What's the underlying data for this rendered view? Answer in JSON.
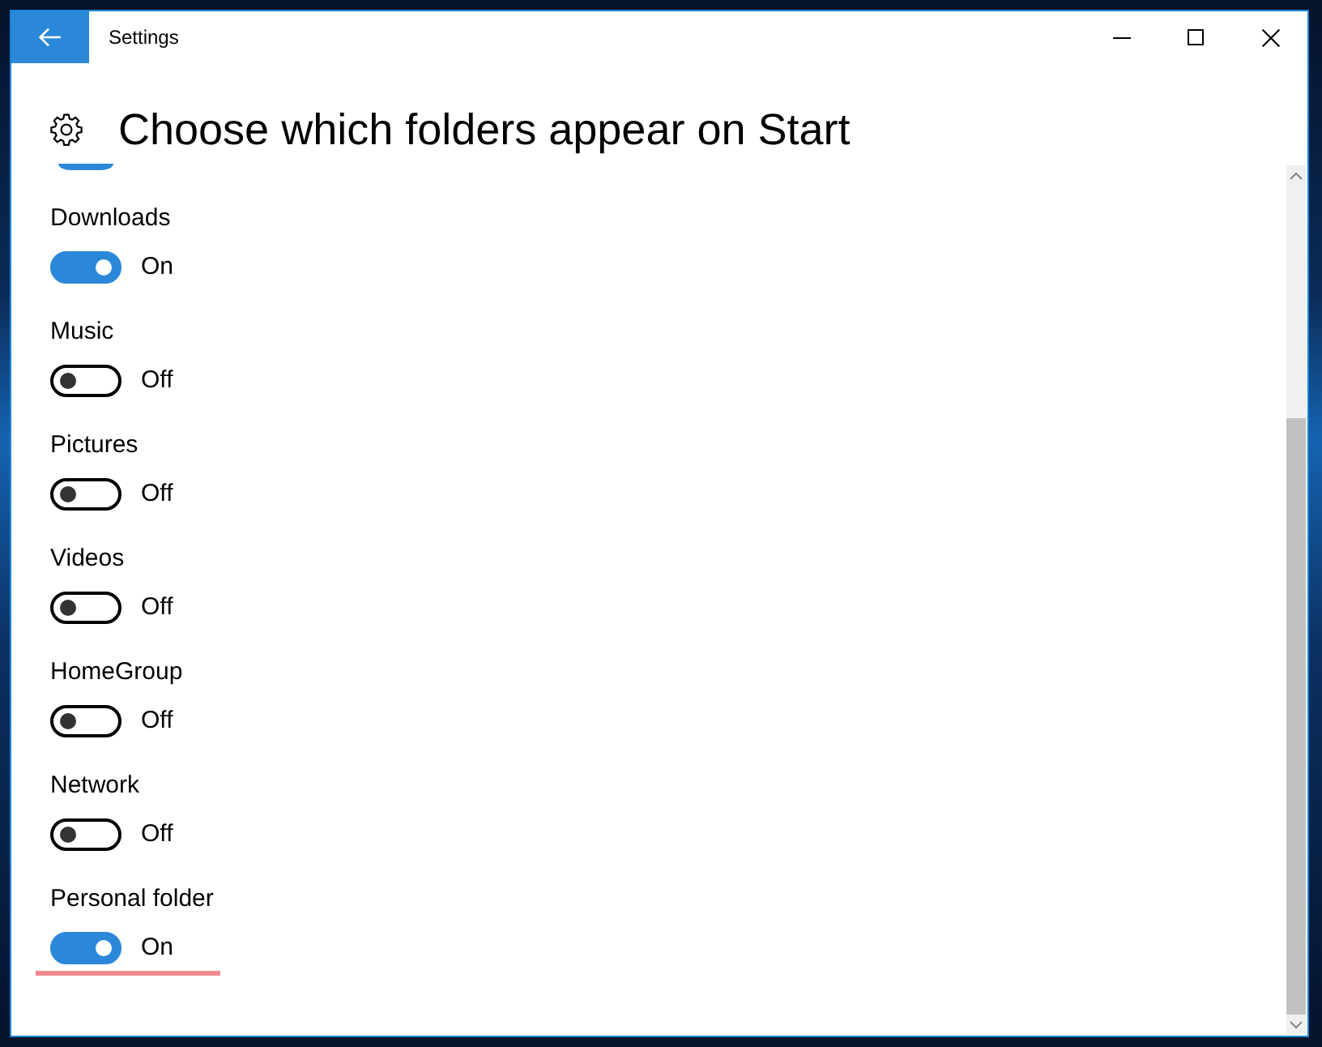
{
  "window": {
    "title": "Settings"
  },
  "page": {
    "title": "Choose which folders appear on Start"
  },
  "clipped_toggle": {
    "on": true
  },
  "folders": [
    {
      "label": "Downloads",
      "on": true,
      "state_text": "On",
      "underlined": false
    },
    {
      "label": "Music",
      "on": false,
      "state_text": "Off",
      "underlined": false
    },
    {
      "label": "Pictures",
      "on": false,
      "state_text": "Off",
      "underlined": false
    },
    {
      "label": "Videos",
      "on": false,
      "state_text": "Off",
      "underlined": false
    },
    {
      "label": "HomeGroup",
      "on": false,
      "state_text": "Off",
      "underlined": false
    },
    {
      "label": "Network",
      "on": false,
      "state_text": "Off",
      "underlined": false
    },
    {
      "label": "Personal folder",
      "on": true,
      "state_text": "On",
      "underlined": true
    }
  ]
}
